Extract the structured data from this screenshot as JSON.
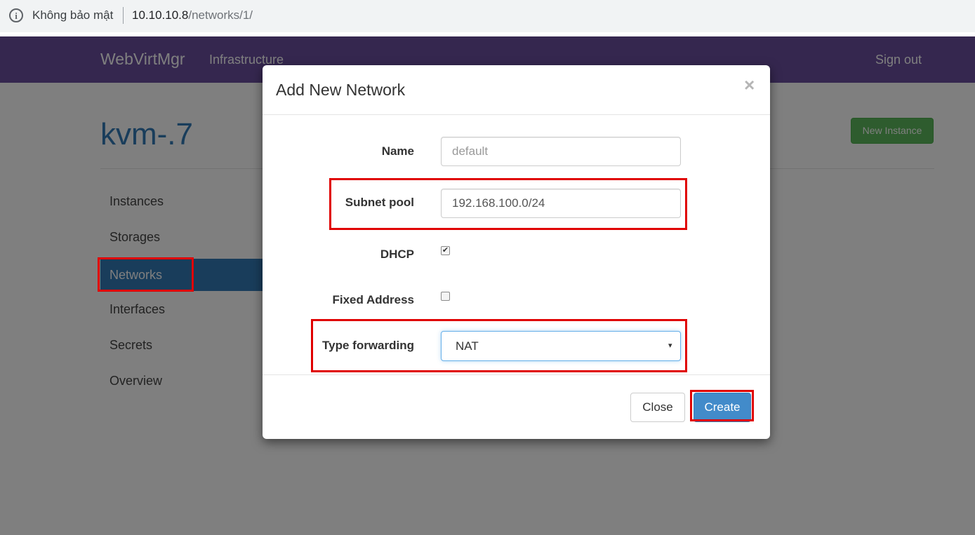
{
  "browser": {
    "security_label": "Không bảo mật",
    "url_host": "10.10.10.8",
    "url_path": "/networks/1/"
  },
  "navbar": {
    "brand": "WebVirtMgr",
    "infrastructure": "Infrastructure",
    "sign_out": "Sign out"
  },
  "page": {
    "title": "kvm-.7",
    "new_instance": "New Instance"
  },
  "sidebar": {
    "items": [
      {
        "label": "Instances"
      },
      {
        "label": "Storages"
      },
      {
        "label": "Networks",
        "active": true
      },
      {
        "label": "Interfaces"
      },
      {
        "label": "Secrets"
      },
      {
        "label": "Overview"
      }
    ]
  },
  "modal": {
    "title": "Add New Network",
    "close_icon": "×",
    "fields": {
      "name": {
        "label": "Name",
        "value": "",
        "placeholder": "default"
      },
      "subnet_pool": {
        "label": "Subnet pool",
        "value": "192.168.100.0/24"
      },
      "dhcp": {
        "label": "DHCP",
        "checked": true,
        "mark": "✔"
      },
      "fixed_address": {
        "label": "Fixed Address",
        "checked": false
      },
      "type_forwarding": {
        "label": "Type forwarding",
        "value": "NAT",
        "caret": "▾"
      }
    },
    "buttons": {
      "close": "Close",
      "create": "Create"
    }
  },
  "colors": {
    "navbar": "#6b4f9f",
    "link_blue": "#337ab7",
    "success": "#5cb85c",
    "primary": "#428bca",
    "annotation_red": "#e00000"
  }
}
